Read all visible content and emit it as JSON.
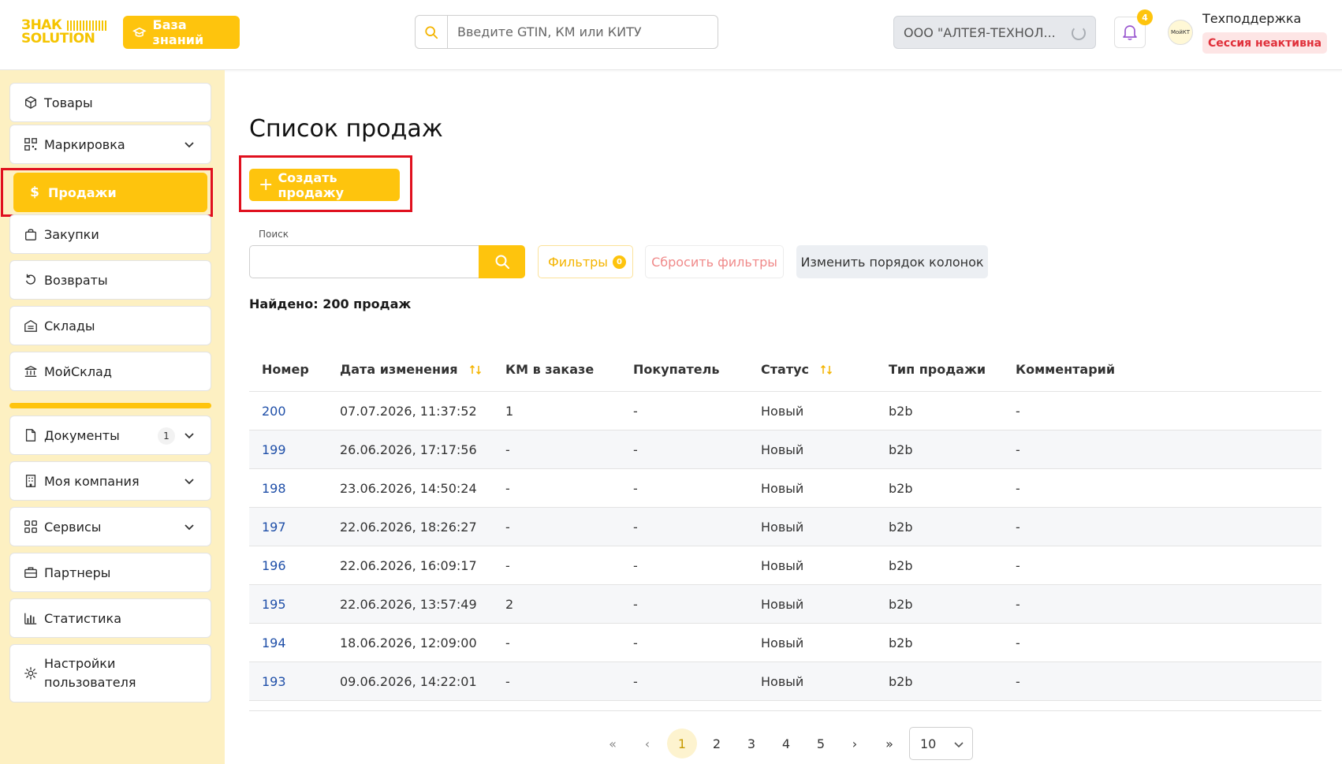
{
  "header": {
    "logo_line1": "ЗНАК",
    "logo_line2": "SOLUTION",
    "knowledge_base_label": "База знаний",
    "search_placeholder": "Введите GTIN, КМ или КИТУ",
    "company_name": "ООО \"АЛТЕЯ-ТЕХНОЛ...",
    "notifications_count": "4",
    "user_name": "Техподдержка",
    "session_status": "Сессия неактивна",
    "avatar_text": "МойКТ"
  },
  "sidebar": {
    "items": [
      {
        "label": "Товары",
        "icon": "box-icon"
      },
      {
        "label": "Маркировка",
        "icon": "qr-code-icon"
      },
      {
        "label": "Продажи",
        "icon": "dollar-icon"
      },
      {
        "label": "Закупки",
        "icon": "shopping-bag-icon"
      },
      {
        "label": "Возвраты",
        "icon": "return-icon"
      },
      {
        "label": "Склады",
        "icon": "warehouse-icon"
      },
      {
        "label": "МойСклад",
        "icon": "bank-icon"
      },
      {
        "label": "Документы",
        "icon": "document-icon",
        "badge": "1"
      },
      {
        "label": "Моя компания",
        "icon": "building-icon"
      },
      {
        "label": "Сервисы",
        "icon": "grid-icon"
      },
      {
        "label": "Партнеры",
        "icon": "briefcase-icon"
      },
      {
        "label": "Статистика",
        "icon": "bar-chart-icon"
      },
      {
        "label_line1": "Настройки",
        "label_line2": "пользователя",
        "icon": "gear-icon"
      }
    ],
    "active_item": "Продажи"
  },
  "main": {
    "title": "Список продаж",
    "create_button": "Создать продажу",
    "search_label": "Поиск",
    "search_value": "",
    "filters_label": "Фильтры",
    "filters_count": "0",
    "reset_filters_label": "Сбросить фильтры",
    "reorder_columns_label": "Изменить порядок колонок",
    "found_text": "Найдено: 200 продаж"
  },
  "table": {
    "columns": [
      "Номер",
      "Дата изменения",
      "КМ в заказе",
      "Покупатель",
      "Статус",
      "Тип продажи",
      "Комментарий"
    ],
    "rows": [
      [
        "200",
        "07.07.2026, 11:37:52",
        "1",
        "-",
        "Новый",
        "b2b",
        "-"
      ],
      [
        "199",
        "26.06.2026, 17:17:56",
        "-",
        "-",
        "Новый",
        "b2b",
        "-"
      ],
      [
        "198",
        "23.06.2026, 14:50:24",
        "-",
        "-",
        "Новый",
        "b2b",
        "-"
      ],
      [
        "197",
        "22.06.2026, 18:26:27",
        "-",
        "-",
        "Новый",
        "b2b",
        "-"
      ],
      [
        "196",
        "22.06.2026, 16:09:17",
        "-",
        "-",
        "Новый",
        "b2b",
        "-"
      ],
      [
        "195",
        "22.06.2026, 13:57:49",
        "2",
        "-",
        "Новый",
        "b2b",
        "-"
      ],
      [
        "194",
        "18.06.2026, 12:09:00",
        "-",
        "-",
        "Новый",
        "b2b",
        "-"
      ],
      [
        "193",
        "09.06.2026, 14:22:01",
        "-",
        "-",
        "Новый",
        "b2b",
        "-"
      ]
    ]
  },
  "pagination": {
    "first": "«",
    "prev": "‹",
    "pages": [
      "1",
      "2",
      "3",
      "4",
      "5"
    ],
    "current": "1",
    "next": "›",
    "last": "»",
    "page_size": "10"
  },
  "colors": {
    "accent": "#fec40d",
    "sidebar_bg": "#fdf0c2",
    "link": "#1f4fa8",
    "highlight_box": "#e0101e",
    "session_text": "#e0303a"
  }
}
